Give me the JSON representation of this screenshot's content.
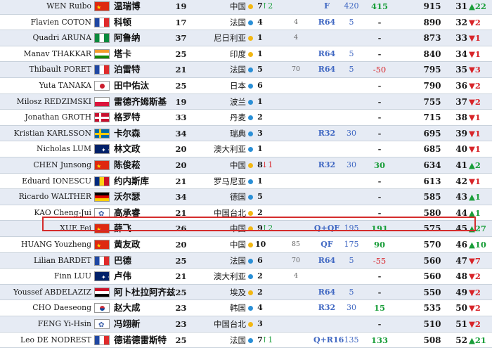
{
  "rows": [
    {
      "name": "WEN Ruibo",
      "flag": "cn",
      "cname": "温瑞博",
      "age": "19",
      "country": "中国",
      "dot": "gold",
      "rank": "7",
      "delta": "↑2",
      "delta_dir": "up",
      "mid": "",
      "stage": "F",
      "stage_pts": "420",
      "pts": "415",
      "pts_type": "pos",
      "total": "915",
      "new_rank": "31",
      "chg": "▲22",
      "chg_dir": "up"
    },
    {
      "name": "Flavien COTON",
      "flag": "fr",
      "cname": "科顿",
      "age": "17",
      "country": "法国",
      "dot": "blue",
      "rank": "4",
      "delta": "",
      "delta_dir": "",
      "mid": "4",
      "stage": "R64",
      "stage_pts": "5",
      "pts": "-",
      "pts_type": "dash",
      "total": "890",
      "new_rank": "32",
      "chg": "▼2",
      "chg_dir": "down"
    },
    {
      "name": "Quadri ARUNA",
      "flag": "ng",
      "cname": "阿鲁纳",
      "age": "37",
      "country": "尼日利亚",
      "dot": "gold",
      "rank": "1",
      "delta": "",
      "delta_dir": "",
      "mid": "4",
      "stage": "",
      "stage_pts": "",
      "pts": "-",
      "pts_type": "dash",
      "total": "873",
      "new_rank": "33",
      "chg": "▼1",
      "chg_dir": "down"
    },
    {
      "name": "Manav THAKKAR",
      "flag": "in",
      "cname": "塔卡",
      "age": "25",
      "country": "印度",
      "dot": "gold",
      "rank": "1",
      "delta": "",
      "delta_dir": "",
      "mid": "",
      "stage": "R64",
      "stage_pts": "5",
      "pts": "-",
      "pts_type": "dash",
      "total": "840",
      "new_rank": "34",
      "chg": "▼1",
      "chg_dir": "down"
    },
    {
      "name": "Thibault PORET",
      "flag": "fr",
      "cname": "泊雷特",
      "age": "21",
      "country": "法国",
      "dot": "blue",
      "rank": "5",
      "delta": "",
      "delta_dir": "",
      "mid": "70",
      "stage": "R64",
      "stage_pts": "5",
      "pts": "-50",
      "pts_type": "neg",
      "total": "795",
      "new_rank": "35",
      "chg": "▼3",
      "chg_dir": "down"
    },
    {
      "name": "Yuta TANAKA",
      "flag": "jp",
      "cname": "田中佑汰",
      "age": "25",
      "country": "日本",
      "dot": "blue",
      "rank": "6",
      "delta": "",
      "delta_dir": "",
      "mid": "",
      "stage": "",
      "stage_pts": "",
      "pts": "-",
      "pts_type": "dash",
      "total": "790",
      "new_rank": "36",
      "chg": "▼2",
      "chg_dir": "down"
    },
    {
      "name": "Milosz REDZIMSKI",
      "flag": "pl",
      "cname": "雷德齐姆斯基",
      "age": "19",
      "country": "波兰",
      "dot": "blue",
      "rank": "1",
      "delta": "",
      "delta_dir": "",
      "mid": "",
      "stage": "",
      "stage_pts": "",
      "pts": "-",
      "pts_type": "dash",
      "total": "755",
      "new_rank": "37",
      "chg": "▼2",
      "chg_dir": "down"
    },
    {
      "name": "Jonathan GROTH",
      "flag": "dk",
      "cname": "格罗特",
      "age": "33",
      "country": "丹麦",
      "dot": "blue",
      "rank": "2",
      "delta": "",
      "delta_dir": "",
      "mid": "",
      "stage": "",
      "stage_pts": "",
      "pts": "-",
      "pts_type": "dash",
      "total": "715",
      "new_rank": "38",
      "chg": "▼1",
      "chg_dir": "down"
    },
    {
      "name": "Kristian KARLSSON",
      "flag": "se",
      "cname": "卡尔森",
      "age": "34",
      "country": "瑞典",
      "dot": "blue",
      "rank": "3",
      "delta": "",
      "delta_dir": "",
      "mid": "",
      "stage": "R32",
      "stage_pts": "30",
      "pts": "-",
      "pts_type": "dash",
      "total": "695",
      "new_rank": "39",
      "chg": "▼1",
      "chg_dir": "down"
    },
    {
      "name": "Nicholas LUM",
      "flag": "au",
      "cname": "林文政",
      "age": "20",
      "country": "澳大利亚",
      "dot": "blue",
      "rank": "1",
      "delta": "",
      "delta_dir": "",
      "mid": "",
      "stage": "",
      "stage_pts": "",
      "pts": "-",
      "pts_type": "dash",
      "total": "685",
      "new_rank": "40",
      "chg": "▼1",
      "chg_dir": "down"
    },
    {
      "name": "CHEN Junsong",
      "flag": "cn",
      "cname": "陈俊菘",
      "age": "20",
      "country": "中国",
      "dot": "gold",
      "rank": "8",
      "delta": "↓1",
      "delta_dir": "down",
      "mid": "",
      "stage": "R32",
      "stage_pts": "30",
      "pts": "30",
      "pts_type": "pos",
      "total": "634",
      "new_rank": "41",
      "chg": "▲2",
      "chg_dir": "up"
    },
    {
      "name": "Eduard IONESCU",
      "flag": "ro",
      "cname": "约内斯库",
      "age": "21",
      "country": "罗马尼亚",
      "dot": "blue",
      "rank": "1",
      "delta": "",
      "delta_dir": "",
      "mid": "",
      "stage": "",
      "stage_pts": "",
      "pts": "-",
      "pts_type": "dash",
      "total": "613",
      "new_rank": "42",
      "chg": "▼1",
      "chg_dir": "down"
    },
    {
      "name": "Ricardo WALTHER",
      "flag": "de",
      "cname": "沃尔瑟",
      "age": "34",
      "country": "德国",
      "dot": "blue",
      "rank": "5",
      "delta": "",
      "delta_dir": "",
      "mid": "",
      "stage": "",
      "stage_pts": "",
      "pts": "-",
      "pts_type": "dash",
      "total": "585",
      "new_rank": "43",
      "chg": "▲1",
      "chg_dir": "up"
    },
    {
      "name": "KAO Cheng-Jui",
      "flag": "tw",
      "cname": "高承睿",
      "age": "21",
      "country": "中国台北",
      "dot": "gold",
      "rank": "2",
      "delta": "",
      "delta_dir": "",
      "mid": "",
      "stage": "",
      "stage_pts": "",
      "pts": "-",
      "pts_type": "dash",
      "total": "580",
      "new_rank": "44",
      "chg": "▲1",
      "chg_dir": "up"
    },
    {
      "name": "XUE Fei",
      "flag": "cn",
      "cname": "薛飞",
      "age": "26",
      "country": "中国",
      "dot": "gold",
      "rank": "9",
      "delta": "↑2",
      "delta_dir": "up",
      "mid": "",
      "stage": "Q+QF",
      "stage_pts": "195",
      "pts": "191",
      "pts_type": "pos",
      "total": "575",
      "new_rank": "45",
      "chg": "▲27",
      "chg_dir": "up"
    },
    {
      "name": "HUANG Youzheng",
      "flag": "cn",
      "cname": "黄友政",
      "age": "20",
      "country": "中国",
      "dot": "gold",
      "rank": "10",
      "delta": "",
      "delta_dir": "",
      "mid": "85",
      "stage": "QF",
      "stage_pts": "175",
      "pts": "90",
      "pts_type": "pos",
      "total": "570",
      "new_rank": "46",
      "chg": "▲10",
      "chg_dir": "up"
    },
    {
      "name": "Lilian BARDET",
      "flag": "fr",
      "cname": "巴德",
      "age": "25",
      "country": "法国",
      "dot": "blue",
      "rank": "6",
      "delta": "",
      "delta_dir": "",
      "mid": "70",
      "stage": "R64",
      "stage_pts": "5",
      "pts": "-55",
      "pts_type": "neg",
      "total": "560",
      "new_rank": "47",
      "chg": "▼7",
      "chg_dir": "down"
    },
    {
      "name": "Finn LUU",
      "flag": "au",
      "cname": "卢伟",
      "age": "21",
      "country": "澳大利亚",
      "dot": "blue",
      "rank": "2",
      "delta": "",
      "delta_dir": "",
      "mid": "4",
      "stage": "",
      "stage_pts": "",
      "pts": "-",
      "pts_type": "dash",
      "total": "560",
      "new_rank": "48",
      "chg": "▼2",
      "chg_dir": "down"
    },
    {
      "name": "Youssef ABDELAZIZ",
      "flag": "eg",
      "cname": "阿卜杜拉阿齐兹",
      "age": "25",
      "country": "埃及",
      "dot": "gold",
      "rank": "2",
      "delta": "",
      "delta_dir": "",
      "mid": "",
      "stage": "R64",
      "stage_pts": "5",
      "pts": "-",
      "pts_type": "dash",
      "total": "550",
      "new_rank": "49",
      "chg": "▼2",
      "chg_dir": "down"
    },
    {
      "name": "CHO Daeseong",
      "flag": "kr",
      "cname": "赵大成",
      "age": "23",
      "country": "韩国",
      "dot": "blue",
      "rank": "4",
      "delta": "",
      "delta_dir": "",
      "mid": "",
      "stage": "R32",
      "stage_pts": "30",
      "pts": "15",
      "pts_type": "pos",
      "total": "535",
      "new_rank": "50",
      "chg": "▼2",
      "chg_dir": "down"
    },
    {
      "name": "FENG Yi-Hsin",
      "flag": "tw",
      "cname": "冯翊新",
      "age": "23",
      "country": "中国台北",
      "dot": "gold",
      "rank": "3",
      "delta": "",
      "delta_dir": "",
      "mid": "",
      "stage": "",
      "stage_pts": "",
      "pts": "-",
      "pts_type": "dash",
      "total": "510",
      "new_rank": "51",
      "chg": "▼2",
      "chg_dir": "down"
    },
    {
      "name": "Leo DE NODREST",
      "flag": "fr",
      "cname": "德诺德雷斯特",
      "age": "25",
      "country": "法国",
      "dot": "blue",
      "rank": "7",
      "delta": "↑1",
      "delta_dir": "up",
      "mid": "",
      "stage": "Q+R16",
      "stage_pts": "135",
      "pts": "133",
      "pts_type": "pos",
      "total": "508",
      "new_rank": "52",
      "chg": "▲21",
      "chg_dir": "up"
    }
  ],
  "highlighted_row": "XUE Fei"
}
